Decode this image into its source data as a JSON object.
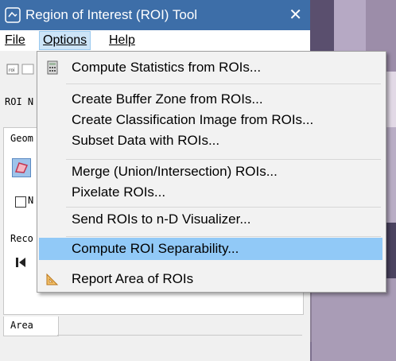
{
  "window": {
    "title": "Region of Interest (ROI) Tool",
    "close_glyph": "✕"
  },
  "menubar": {
    "file": "File",
    "options": "Options",
    "help": "Help"
  },
  "content": {
    "roi_label": "ROI N",
    "geometry_label": "Geom",
    "checkbox_fragment": "N",
    "record_label": "Reco",
    "tab_label": "Area"
  },
  "menu": {
    "items": [
      {
        "label": "Compute Statistics from ROIs...",
        "icon": "calculator-icon"
      },
      {
        "label": "Create Buffer Zone from ROIs..."
      },
      {
        "label": "Create Classification Image from ROIs..."
      },
      {
        "label": "Subset Data with ROIs..."
      },
      {
        "label": "Merge (Union/Intersection) ROIs..."
      },
      {
        "label": "Pixelate ROIs..."
      },
      {
        "label": "Send ROIs to n-D Visualizer..."
      },
      {
        "label": "Compute ROI Separability...",
        "highlighted": true
      },
      {
        "label": "Report Area of ROIs",
        "icon": "triangle-ruler-icon"
      }
    ]
  },
  "colors": {
    "titlebar": "#3d6ea8",
    "menu_highlight": "#91c9f7",
    "menu_bg": "#f2f2f2"
  }
}
